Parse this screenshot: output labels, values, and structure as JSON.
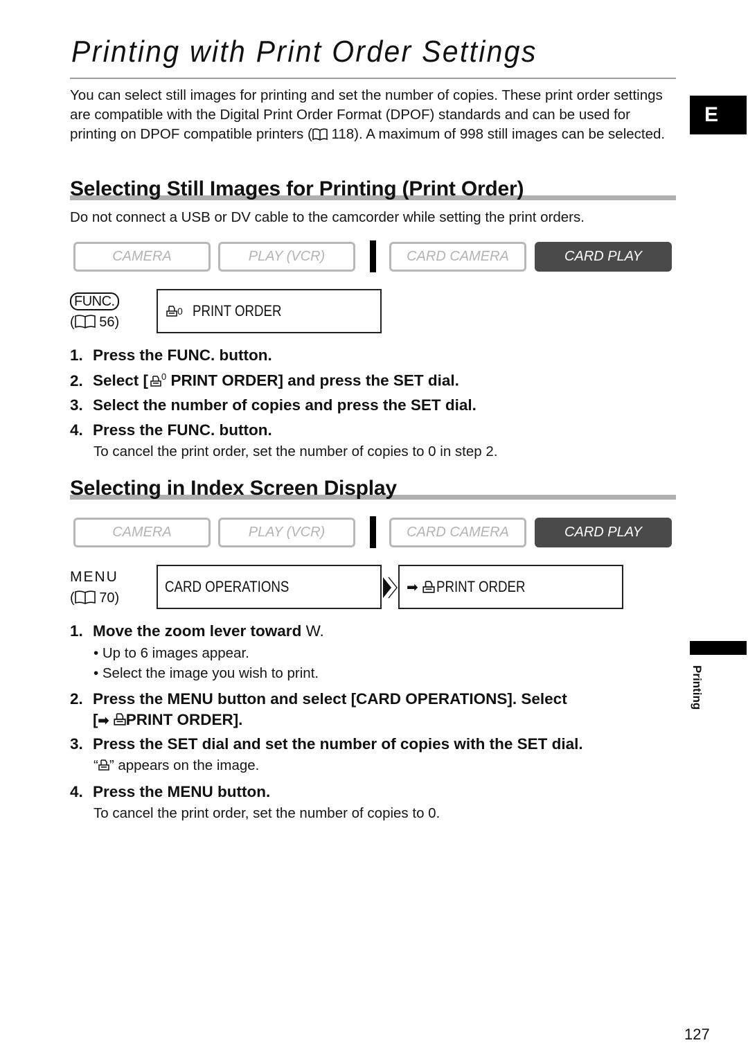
{
  "page": {
    "title": "Printing with Print Order Settings",
    "language_tab": "E",
    "side_label": "Printing",
    "page_number": "127"
  },
  "intro": {
    "text_before_ref": "You can select still images for printing and set the number of copies. These print order settings are compatible with the Digital Print Order Format (DPOF) standards and can be used for printing on DPOF compatible printers (",
    "ref_page": "118",
    "text_after_ref": "). A maximum of 998 still images can be selected."
  },
  "section1": {
    "heading": "Selecting Still Images for Printing (Print Order)",
    "note": "Do not connect a USB or DV cable to the camcorder while setting the print orders.",
    "modes": [
      {
        "label": "CAMERA",
        "active": false
      },
      {
        "label": "PLAY (VCR)",
        "active": false
      },
      {
        "label": "CARD CAMERA",
        "active": false
      },
      {
        "label": "CARD PLAY",
        "active": true
      }
    ],
    "key": {
      "label": "FUNC.",
      "ref_open": "(",
      "ref_page": "56",
      "ref_close": ")"
    },
    "lcd": {
      "icon": "print-order-icon",
      "superscript": "0",
      "text": "PRINT ORDER"
    },
    "steps": [
      {
        "num": "1.",
        "text": "Press the FUNC. button."
      },
      {
        "num": "2.",
        "text_before": "Select [",
        "superscript": "0",
        "text_after": " PRINT ORDER] and press the SET dial."
      },
      {
        "num": "3.",
        "text": "Select the number of copies and press the SET dial."
      },
      {
        "num": "4.",
        "text": "Press the FUNC. button."
      }
    ],
    "step4_note": "To cancel the print order, set the number of copies to 0 in step 2."
  },
  "section2": {
    "heading": "Selecting in Index Screen Display",
    "modes": [
      {
        "label": "CAMERA",
        "active": false
      },
      {
        "label": "PLAY (VCR)",
        "active": false
      },
      {
        "label": "CARD CAMERA",
        "active": false
      },
      {
        "label": "CARD PLAY",
        "active": true
      }
    ],
    "key": {
      "label": "MENU",
      "ref_open": "(",
      "ref_page": "70",
      "ref_close": ")"
    },
    "lcd1": {
      "text": "CARD OPERATIONS"
    },
    "lcd2": {
      "arrow": "➡",
      "text": "PRINT ORDER"
    },
    "steps": [
      {
        "num": "1.",
        "text_bold": "Move the zoom lever toward ",
        "text_plain": "W."
      },
      {
        "num": "2.",
        "line1": "Press the MENU button and select [CARD OPERATIONS]. Select",
        "line2_open": "[",
        "line2_arrow": "➡",
        "line2_text": "PRINT ORDER]."
      },
      {
        "num": "3.",
        "text": "Press the SET dial and set the number of copies with the SET dial."
      },
      {
        "num": "4.",
        "text": "Press the MENU button."
      }
    ],
    "step1_bullets": [
      "Up to 6 images appear.",
      "Select the image you wish to print."
    ],
    "step3_note_open": "“",
    "step3_note_close": "” appears on the image.",
    "step4_note": "To cancel the print order, set the number of copies to 0."
  }
}
